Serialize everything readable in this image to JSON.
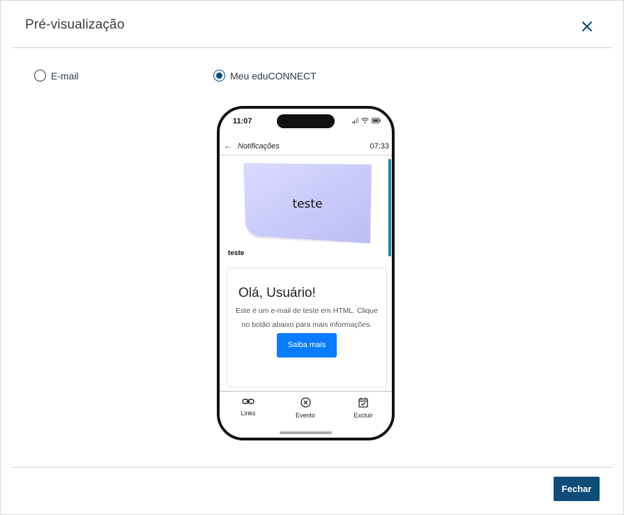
{
  "modal": {
    "title": "Pré-visualização",
    "close_icon": "close-icon",
    "accent_color": "#0f4c7a"
  },
  "options": [
    {
      "label": "E-mail",
      "selected": false
    },
    {
      "label": "Meu eduCONNECT",
      "selected": true
    }
  ],
  "phone": {
    "status_time": "11:07",
    "app_title": "Notificações",
    "app_time": "07:33",
    "image_text": "teste",
    "caption": "teste",
    "email": {
      "heading": "Olá, Usuário!",
      "body": "Este é um e-mail de teste em HTML. Clique no botão abaixo para mais informações.",
      "button": "Saiba mais",
      "button_color": "#0a7cff"
    },
    "nav": [
      {
        "label": "Links",
        "icon": "link-icon"
      },
      {
        "label": "Evento",
        "icon": "close-circle-icon"
      },
      {
        "label": "Excluir",
        "icon": "calendar-check-icon"
      }
    ]
  },
  "footer": {
    "close_button": "Fechar"
  }
}
